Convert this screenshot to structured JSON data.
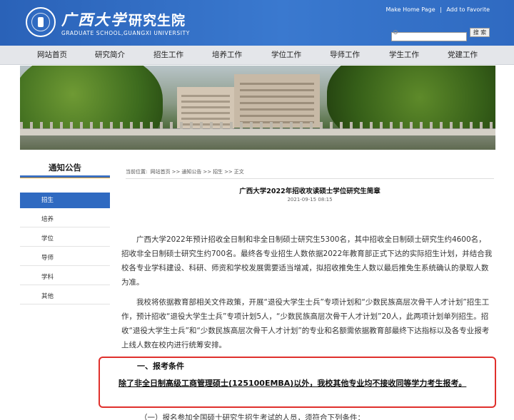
{
  "header": {
    "logo_cn": "广西大学",
    "logo_cn2": "研究生院",
    "logo_en": "GRADUATE SCHOOL,GUANGXI UNIVERSITY",
    "links": [
      "Make Home Page",
      "|",
      "Add to Favorite"
    ],
    "search": {
      "value": "",
      "button": "搜 索"
    }
  },
  "nav": {
    "items": [
      "网站首页",
      "研究简介",
      "招生工作",
      "培养工作",
      "学位工作",
      "导师工作",
      "学生工作",
      "党建工作"
    ]
  },
  "sidebar": {
    "title": "通知公告",
    "items": [
      "招生",
      "培养",
      "学位",
      "导师",
      "学科",
      "其他"
    ],
    "active_index": 0
  },
  "breadcrumb": [
    "当前位置:",
    "网站首页",
    ">>",
    "通知公告",
    ">>",
    "招生",
    ">>",
    "正文"
  ],
  "article": {
    "title": "广西大学2022年招收攻读硕士学位研究生简章",
    "date": "2021-09-15 08:15",
    "para1": "广西大学2022年预计招收全日制和非全日制硕士研究生5300名，其中招收全日制硕士研究生约4600名，招收非全日制硕士研究生约700名。最终各专业招生人数依据2022年教育部正式下达的实际招生计划，并结合我校各专业学科建设、科研、师资和学校发展需要适当增减，拟招收推免生人数以最后推免生系统确认的录取人数为准。",
    "para2": "我校将依据教育部相关文件政策，开展“退役大学生士兵”专项计划和“少数民族高层次骨干人才计划”招生工作，预计招收“退役大学生士兵”专项计划5人，“少数民族高层次骨干人才计划”20人，此两项计划单列招生。招收“退役大学生士兵”和“少数民族高层次骨干人才计划”的专业和名额需依据教育部最终下达指标以及各专业报考上线人数在校内进行统筹安排。",
    "section_title": "一、报考条件",
    "section_body": "除了非全日制高级工商管理硕士(125100EMBA)以外，我校其他专业均不接收同等学力考生报考。",
    "cut_line": "（一）报名参加全国硕士研究生招生考试的人员，须符合下列条件："
  },
  "colors": {
    "header_blue": "#2f6ac1",
    "highlight_red": "#e0302c",
    "nav_bg": "#e4e6ea"
  }
}
